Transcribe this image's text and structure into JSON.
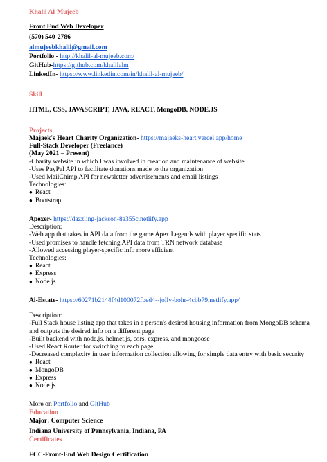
{
  "header": {
    "name": "Khalil Al-Mujeeb",
    "title": "Front End Web Developer",
    "phone": "(570) 540-2786",
    "email": "almujeebkhalil@gmail.com",
    "portfolio_label": "Portfolio - ",
    "portfolio_url": "http://khalil-al-mujeeb.com/",
    "github_label": "GitHub-",
    "github_url": "https://github.com/khalilalm",
    "linkedin_label": "LinkedIn- ",
    "linkedin_url": "https://www.linkedin.com/in/khalil-al-mujeeb/"
  },
  "skill": {
    "heading": "Skill",
    "list": "HTML, CSS,  JAVASCRIPT,  JAVA, REACT,  MongoDB,  NODE.JS"
  },
  "projects": {
    "heading": "Projects",
    "p1": {
      "name": "Majaek's Heart Charity Organization- ",
      "url": "https://majaeks-heart.vercel.app/home",
      "role": "Full-Stack Developer (Freelance)",
      "dates": "(May 2021 – Present)",
      "lines": [
        "-Charity website in which I was involved in creation and maintenance of website.",
        "-Uses PayPal API to facilitate donations made to the organization",
        "-Used MailChimp API for newsletter advertisements and email listings"
      ],
      "tech_label": "Technologies:",
      "tech": [
        "React",
        "Bootstrap"
      ]
    },
    "p2": {
      "name": "Apexer- ",
      "url": "https://dazzling-jackson-8a355c.netlify.app",
      "desc_label": "Description:",
      "lines": [
        "-Web app that takes in API data from the game Apex Legends with player specific stats",
        "-Used promises to handle fetching API data from TRN network database",
        "-Allowed accessing player-specific info more efficient"
      ],
      "tech_label": "Technologies:",
      "tech": [
        "React",
        "Express",
        "Node.js"
      ]
    },
    "p3": {
      "name": "Al-Estate- ",
      "url": "https://60271b2144f4d100072fbed4--jolly-bohr-4cbb79.netlify.app/",
      "desc_label": "Description:",
      "line1": "-Full Stack house listing app that takes in a person's desired housing information from MongoDB schema and outputs the desired info on a different page",
      "lines": [
        "-Built backend with node.js, helmet.js, cors, express, and mongoose",
        "-Used React Router for switching to each page",
        "-Decreased complexity in user information collection allowing for simple data entry with basic security"
      ],
      "tech": [
        "React",
        "MongoDB",
        "Express",
        "Node.js"
      ]
    },
    "more_prefix": "More on ",
    "more_portfolio": "Portfolio",
    "more_and": " and ",
    "more_github": "GitHub"
  },
  "education": {
    "heading": "Education",
    "major": " Major: Computer Science",
    "school": "Indiana University of Pennsylvania, Indiana, PA"
  },
  "certificates": {
    "heading": "Certificates",
    "item": "FCC-Front-End Web Design Certification"
  }
}
